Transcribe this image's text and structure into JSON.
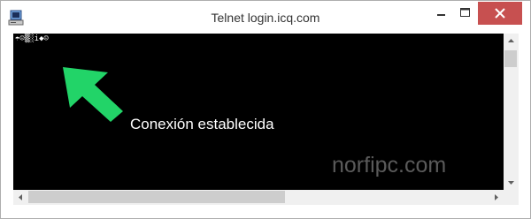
{
  "window": {
    "title": "Telnet login.icq.com",
    "controls": {
      "minimize": "minimize-icon",
      "maximize": "maximize-icon",
      "close": "close-icon"
    },
    "close_color": "#c75050"
  },
  "console": {
    "output": "☂☺▒░i◆☺",
    "background": "#000000"
  },
  "annotation": {
    "text": "Conexión establecida",
    "arrow_color": "#22d468"
  },
  "watermark": {
    "text": "norfipc.com"
  },
  "scrollbars": {
    "vertical_position": 0,
    "horizontal_position": 0
  }
}
